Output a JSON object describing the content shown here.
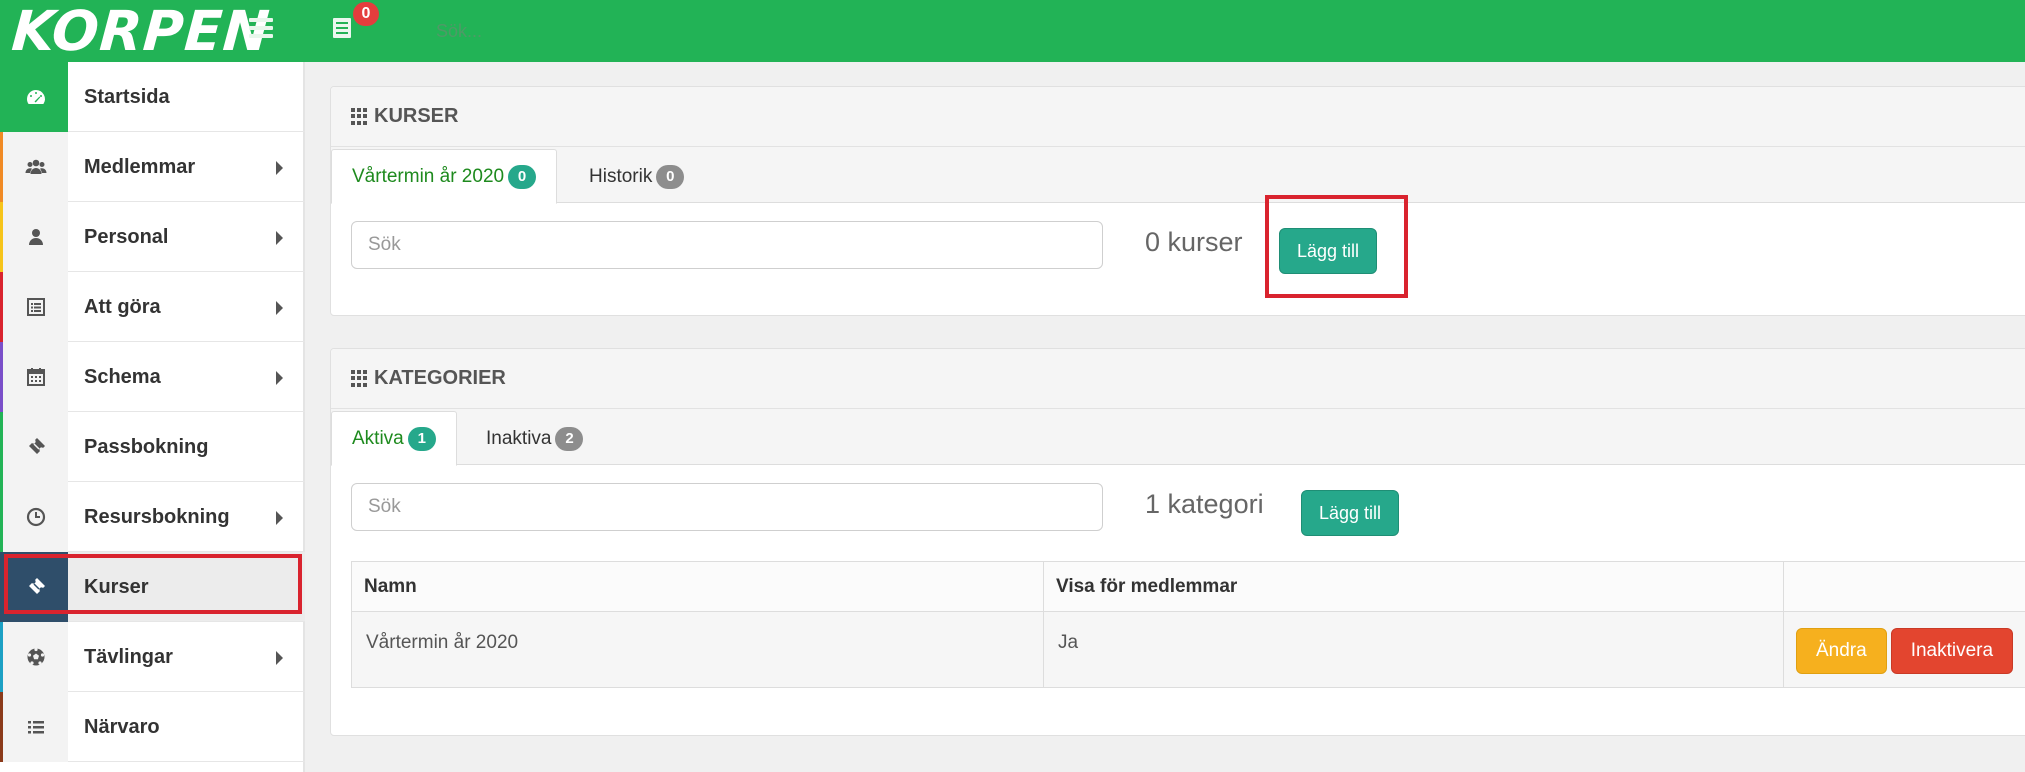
{
  "brand": {
    "logo_text": "KORPEN"
  },
  "topbar": {
    "todo_count": "0",
    "search_placeholder": "Sök..."
  },
  "sidebar": {
    "items": [
      {
        "label": "Startsida",
        "icon": "dashboard-icon",
        "has_submenu": false,
        "accent": "#22b356"
      },
      {
        "label": "Medlemmar",
        "icon": "users-icon",
        "has_submenu": true,
        "accent": "#f08a24"
      },
      {
        "label": "Personal",
        "icon": "user-icon",
        "has_submenu": true,
        "accent": "#f6c41a"
      },
      {
        "label": "Att göra",
        "icon": "list-icon",
        "has_submenu": true,
        "accent": "#d9232e"
      },
      {
        "label": "Schema",
        "icon": "calendar-icon",
        "has_submenu": true,
        "accent": "#7a4fc9"
      },
      {
        "label": "Passbokning",
        "icon": "ticket-icon",
        "has_submenu": false,
        "accent": "#22b356"
      },
      {
        "label": "Resursbokning",
        "icon": "clock-icon",
        "has_submenu": true,
        "accent": "#22b356"
      },
      {
        "label": "Kurser",
        "icon": "ticket-icon",
        "has_submenu": false,
        "accent": "#2f4e6a",
        "selected": true
      },
      {
        "label": "Tävlingar",
        "icon": "soccer-ball-icon",
        "has_submenu": true,
        "accent": "#1ca0c4"
      },
      {
        "label": "Närvaro",
        "icon": "list-lines-icon",
        "has_submenu": false,
        "accent": "#8b3a1a"
      }
    ]
  },
  "courses": {
    "title": "KURSER",
    "tabs": [
      {
        "label": "Vårtermin år 2020",
        "count": "0",
        "active": true
      },
      {
        "label": "Historik",
        "count": "0",
        "active": false
      }
    ],
    "search_placeholder": "Sök",
    "count_text": "0 kurser",
    "add_label": "Lägg till"
  },
  "categories": {
    "title": "KATEGORIER",
    "tabs": [
      {
        "label": "Aktiva",
        "count": "1",
        "active": true
      },
      {
        "label": "Inaktiva",
        "count": "2",
        "active": false
      }
    ],
    "search_placeholder": "Sök",
    "count_text": "1 kategori",
    "add_label": "Lägg till",
    "table": {
      "columns": [
        "Namn",
        "Visa för medlemmar",
        ""
      ],
      "rows": [
        {
          "name": "Vårtermin år 2020",
          "visible": "Ja",
          "edit_label": "Ändra",
          "deactivate_label": "Inaktivera"
        }
      ]
    }
  },
  "colors": {
    "brand_green": "#22b356",
    "teal": "#26a88b",
    "warning": "#f6b01e",
    "danger": "#e3452f",
    "highlight_red": "#d9232e"
  }
}
